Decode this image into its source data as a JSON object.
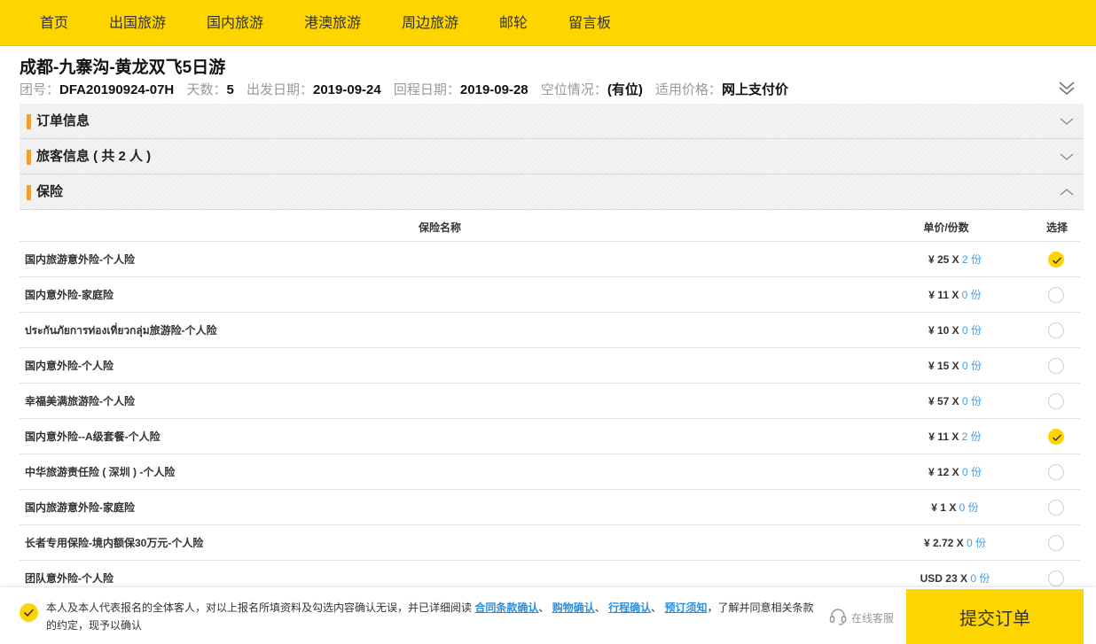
{
  "nav": [
    "首页",
    "出国旅游",
    "国内旅游",
    "港澳旅游",
    "周边旅游",
    "邮轮",
    "留言板"
  ],
  "tour": {
    "title": "成都-九寨沟-黄龙双飞5日游",
    "meta": [
      {
        "label": "团号：",
        "value": "DFA20190924-07H"
      },
      {
        "label": "天数：",
        "value": "5"
      },
      {
        "label": "出发日期：",
        "value": "2019-09-24"
      },
      {
        "label": "回程日期：",
        "value": "2019-09-28"
      },
      {
        "label": "空位情况：",
        "value": "(有位)"
      },
      {
        "label": "适用价格：",
        "value": "网上支付价"
      }
    ]
  },
  "sections": [
    {
      "title": "订单信息",
      "expanded": false
    },
    {
      "title": "旅客信息 ( 共 2 人 )",
      "expanded": false
    },
    {
      "title": "保险",
      "expanded": true
    }
  ],
  "insurance": {
    "headers": {
      "name": "保险名称",
      "price": "单价/份数",
      "select": "选择"
    },
    "rows": [
      {
        "name": "国内旅游意外险-个人险",
        "price": "¥ 25 X",
        "qty": "2 份",
        "selected": true
      },
      {
        "name": "国内意外险-家庭险",
        "price": "¥ 11 X",
        "qty": "0 份",
        "selected": false
      },
      {
        "name": "ประกันภัยการท่องเที่ยวกลุ่ม旅游险-个人险",
        "price": "¥ 10 X",
        "qty": "0 份",
        "selected": false
      },
      {
        "name": "国内意外险-个人险",
        "price": "¥ 15 X",
        "qty": "0 份",
        "selected": false
      },
      {
        "name": "幸福美满旅游险-个人险",
        "price": "¥ 57 X",
        "qty": "0 份",
        "selected": false
      },
      {
        "name": "国内意外险--A级套餐-个人险",
        "price": "¥ 11 X",
        "qty": "2 份",
        "selected": true
      },
      {
        "name": "中华旅游责任险 ( 深圳 ) -个人险",
        "price": "¥ 12 X",
        "qty": "0 份",
        "selected": false
      },
      {
        "name": "国内旅游意外险-家庭险",
        "price": "¥ 1 X",
        "qty": "0 份",
        "selected": false
      },
      {
        "name": "长者专用保险-境内额保30万元-个人险",
        "price": "¥ 2.72 X",
        "qty": "0 份",
        "selected": false
      },
      {
        "name": "团队意外险-个人险",
        "price": "USD 23 X",
        "qty": "0 份",
        "selected": false
      }
    ]
  },
  "footer": {
    "agree_prefix": "本人及本人代表报名的全体客人，对以上报名所填资料及勾选内容确认无误，并已详细阅读",
    "links": [
      "合同条款确认",
      "购物确认",
      "行程确认",
      "预订须知"
    ],
    "separator": "、",
    "agree_suffix": "，了解并同意相关条款的约定，现予以确认",
    "customer_service": "在线客服",
    "submit": "提交订单"
  },
  "colors": {
    "brand": "#ffd500",
    "accent_bar": "#f49e34",
    "link": "#2b8fde"
  }
}
